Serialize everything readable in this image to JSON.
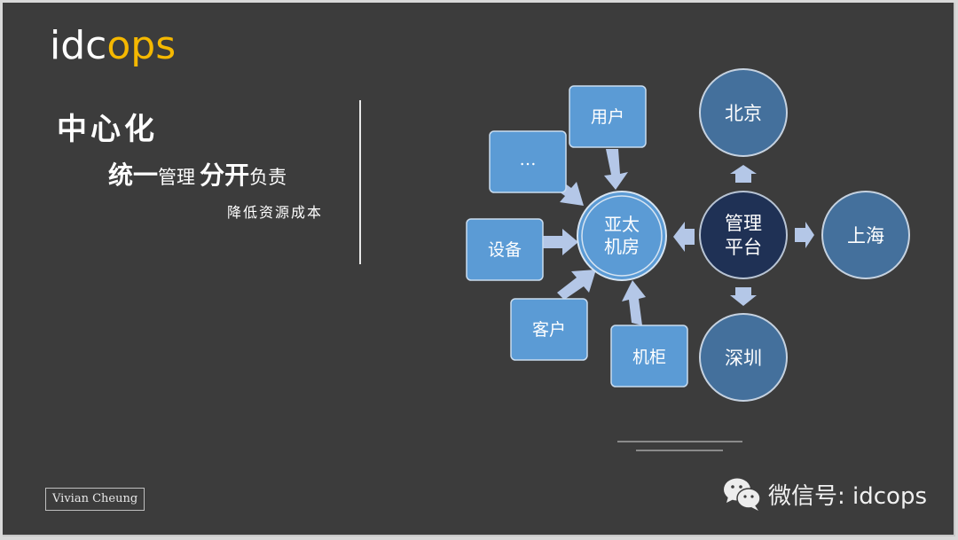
{
  "logo": {
    "part1": "idc",
    "part2": "ops"
  },
  "headline": {
    "title": "中心化",
    "subtitle_big_1": "统一",
    "subtitle_small_1": "管理",
    "subtitle_big_2": "分开",
    "subtitle_small_2": "负责",
    "tagline": "降低资源成本"
  },
  "diagram": {
    "hub": "亚太机房",
    "hub_lines": [
      "亚太",
      "机房"
    ],
    "inputs": [
      "用户",
      "…",
      "设备",
      "客户",
      "机柜"
    ],
    "platform_lines": [
      "管理",
      "平台"
    ],
    "cities": [
      "北京",
      "上海",
      "深圳"
    ],
    "colors": {
      "box": "#5b9bd5",
      "hub": "#5b9bd5",
      "platform": "#1f3155",
      "city": "#44709c",
      "arrow": "#b4c7e7"
    }
  },
  "footer": {
    "author": "Vivian Cheung",
    "wechat": "微信号: idcops"
  }
}
